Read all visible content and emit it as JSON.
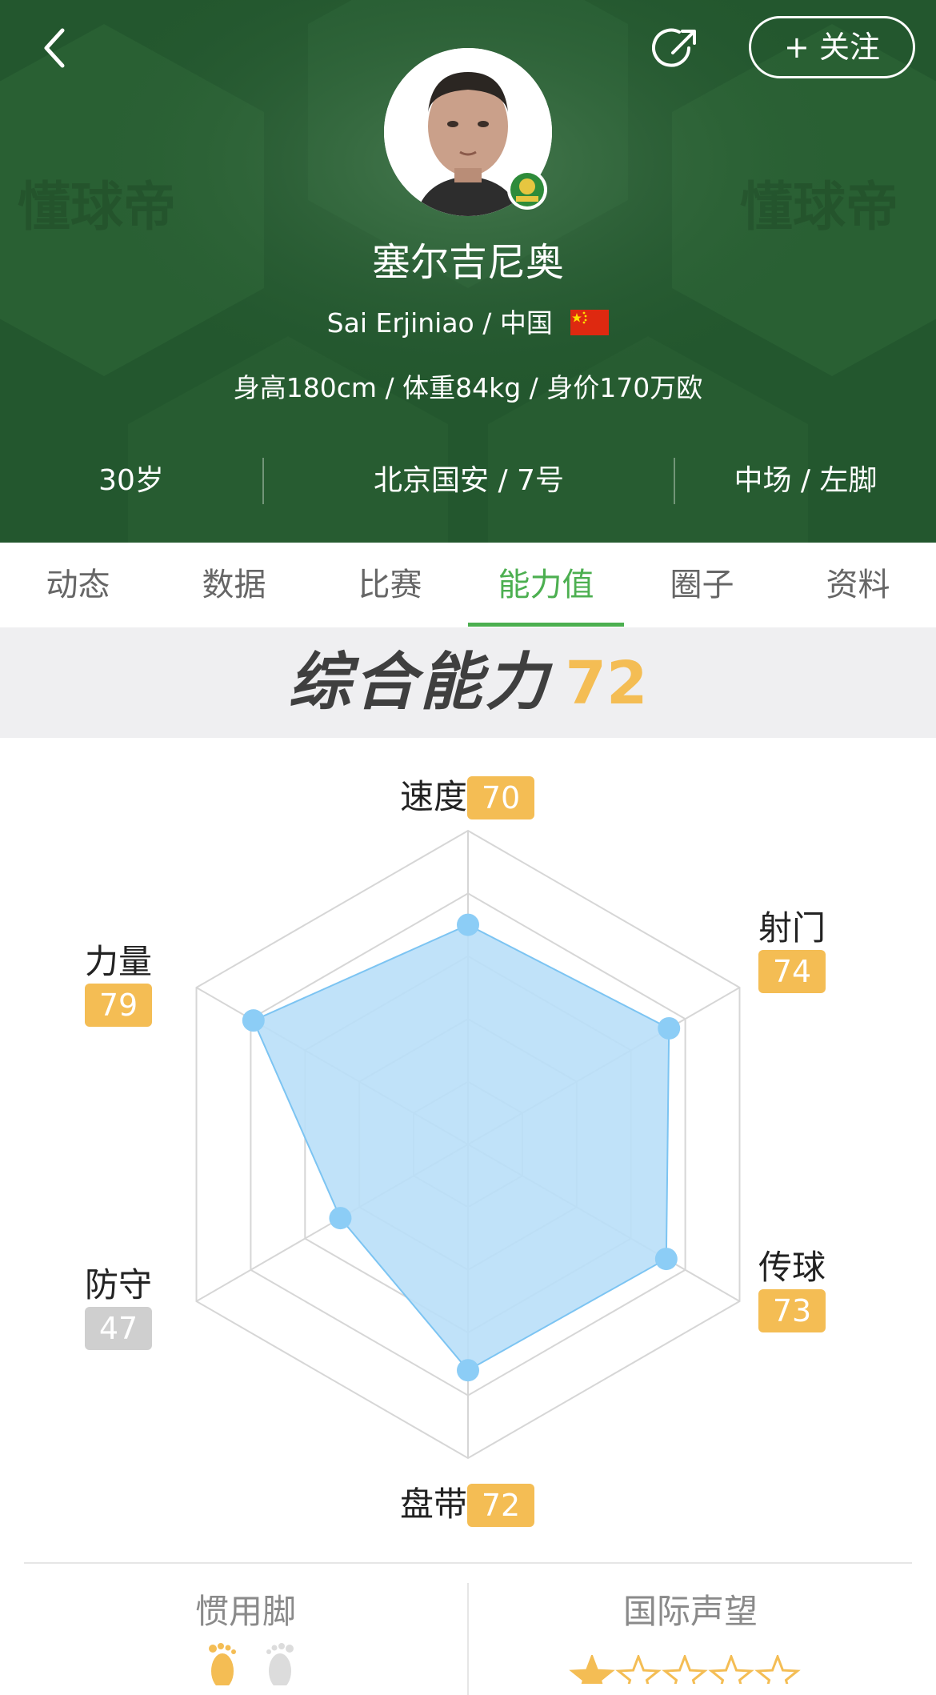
{
  "header": {
    "follow_label": "+ 关注",
    "watermark": "懂球帝",
    "name_cn": "塞尔吉尼奥",
    "name_en_country": "Sai Erjiniao / 中国",
    "body_stats": "身高180cm / 体重84kg / 身价170万欧",
    "age": "30岁",
    "club_number": "北京国安 / 7号",
    "position_foot": "中场 / 左脚",
    "colors": {
      "header_bg": "#23572e",
      "accent": "#4caf50",
      "badge": "#f4bd54"
    },
    "icons": [
      "back-arrow-icon",
      "share-icon",
      "club-badge-icon",
      "china-flag-icon"
    ]
  },
  "tabs": [
    {
      "label": "动态",
      "active": false
    },
    {
      "label": "数据",
      "active": false
    },
    {
      "label": "比赛",
      "active": false
    },
    {
      "label": "能力值",
      "active": true
    },
    {
      "label": "圈子",
      "active": false
    },
    {
      "label": "资料",
      "active": false
    }
  ],
  "overall": {
    "title": "综合能力",
    "value": "72"
  },
  "attributes": {
    "speed": {
      "label": "速度",
      "value": "70"
    },
    "shooting": {
      "label": "射门",
      "value": "74"
    },
    "passing": {
      "label": "传球",
      "value": "73"
    },
    "dribbling": {
      "label": "盘带",
      "value": "72"
    },
    "defense": {
      "label": "防守",
      "value": "47"
    },
    "strength": {
      "label": "力量",
      "value": "79"
    }
  },
  "chart_data": {
    "type": "radar",
    "axes": [
      "速度",
      "射门",
      "传球",
      "盘带",
      "防守",
      "力量"
    ],
    "values": [
      70,
      74,
      73,
      72,
      47,
      79
    ],
    "range": [
      0,
      100
    ],
    "rings": 5,
    "fill_color": "#b9dff8",
    "point_color": "#8ccdf6"
  },
  "bottom": {
    "preferred_foot_title": "惯用脚",
    "preferred_foot": "left",
    "reputation_title": "国际声望",
    "reputation_stars": 1,
    "reputation_max": 5
  }
}
